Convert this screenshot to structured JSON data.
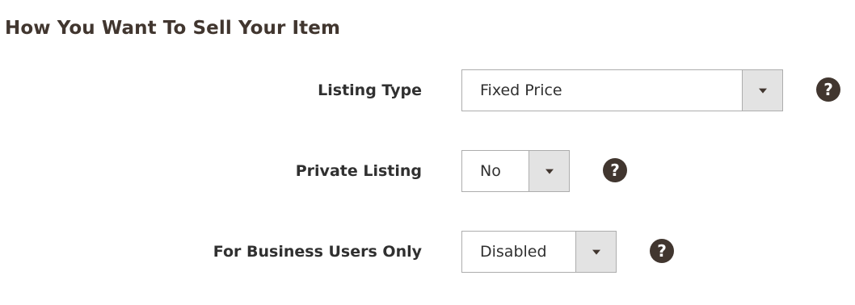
{
  "section": {
    "title": "How You Want To Sell Your Item"
  },
  "fields": [
    {
      "label": "Listing Type",
      "value": "Fixed Price",
      "help_icon": "question-circle-icon",
      "dropdown_icon": "triangle-down-icon"
    },
    {
      "label": "Private Listing",
      "value": "No",
      "help_icon": "question-circle-icon",
      "dropdown_icon": "triangle-down-icon"
    },
    {
      "label": "For Business Users Only",
      "value": "Disabled",
      "help_icon": "question-circle-icon",
      "dropdown_icon": "triangle-down-icon"
    }
  ],
  "help_glyph": "?",
  "colors": {
    "text": "#303030",
    "title": "#41362f",
    "help_bg": "#41362f",
    "select_border": "#adadad",
    "arrow_box_bg": "#e3e3e3"
  }
}
